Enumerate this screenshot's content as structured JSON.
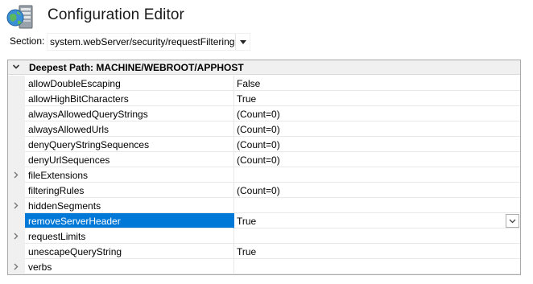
{
  "header": {
    "title": "Configuration Editor",
    "icon": "configuration-editor-icon"
  },
  "section": {
    "label": "Section:",
    "value": "system.webServer/security/requestFiltering"
  },
  "grid": {
    "category": "Deepest Path: MACHINE/WEBROOT/APPHOST",
    "rows": [
      {
        "name": "allowDoubleEscaping",
        "value": "False",
        "expandable": false,
        "selected": false
      },
      {
        "name": "allowHighBitCharacters",
        "value": "True",
        "expandable": false,
        "selected": false
      },
      {
        "name": "alwaysAllowedQueryStrings",
        "value": "(Count=0)",
        "expandable": false,
        "selected": false
      },
      {
        "name": "alwaysAllowedUrls",
        "value": "(Count=0)",
        "expandable": false,
        "selected": false
      },
      {
        "name": "denyQueryStringSequences",
        "value": "(Count=0)",
        "expandable": false,
        "selected": false
      },
      {
        "name": "denyUrlSequences",
        "value": "(Count=0)",
        "expandable": false,
        "selected": false
      },
      {
        "name": "fileExtensions",
        "value": "",
        "expandable": true,
        "selected": false
      },
      {
        "name": "filteringRules",
        "value": "(Count=0)",
        "expandable": false,
        "selected": false
      },
      {
        "name": "hiddenSegments",
        "value": "",
        "expandable": true,
        "selected": false
      },
      {
        "name": "removeServerHeader",
        "value": "True",
        "expandable": false,
        "selected": true
      },
      {
        "name": "requestLimits",
        "value": "",
        "expandable": true,
        "selected": false
      },
      {
        "name": "unescapeQueryString",
        "value": "True",
        "expandable": false,
        "selected": false
      },
      {
        "name": "verbs",
        "value": "",
        "expandable": true,
        "selected": false
      }
    ]
  },
  "colors": {
    "selection": "#0078d7",
    "gutter": "#f0f0f0",
    "grid_border": "#a9a9a9"
  }
}
